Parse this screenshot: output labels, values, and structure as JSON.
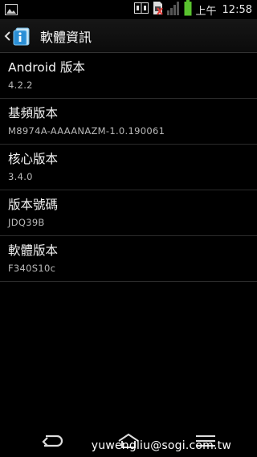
{
  "status_bar": {
    "ampm": "上午",
    "time": "12:58",
    "icons": [
      "gallery-icon",
      "nfc-icon",
      "no-sim-icon",
      "signal-icon",
      "battery-icon"
    ]
  },
  "action_bar": {
    "title": "軟體資訊",
    "icon": "settings-info-icon"
  },
  "items": [
    {
      "title": "Android 版本",
      "value": "4.2.2"
    },
    {
      "title": "基頻版本",
      "value": "M8974A-AAAANAZM-1.0.190061"
    },
    {
      "title": "核心版本",
      "value": "3.4.0"
    },
    {
      "title": "版本號碼",
      "value": "JDQ39B"
    },
    {
      "title": "軟體版本",
      "value": "F340S10c"
    }
  ],
  "watermark": "yuwengliu@sogi.com.tw",
  "colors": {
    "background": "#000000",
    "divider": "#2b2b2b",
    "battery": "#59c22e"
  }
}
